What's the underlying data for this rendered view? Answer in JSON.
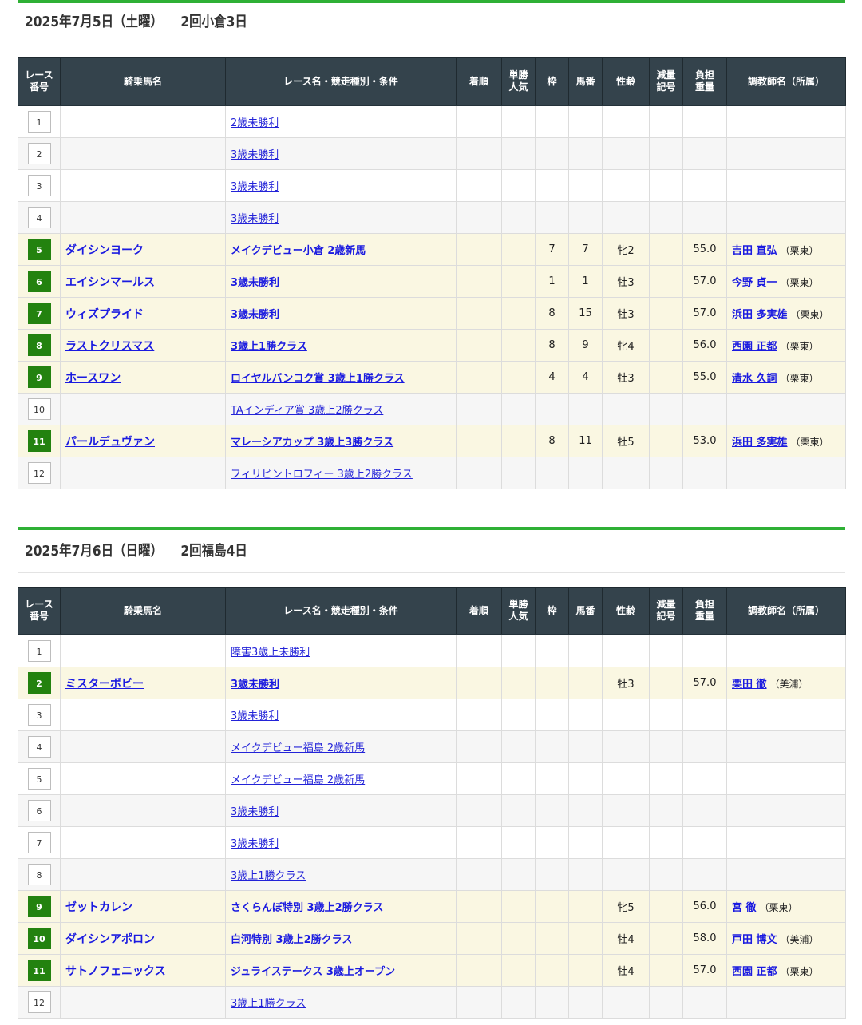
{
  "headers": {
    "race_num": "レース番号",
    "horse": "騎乗馬名",
    "race": "レース名・競走種別・条件",
    "rank": "着順",
    "pop": "単勝人気",
    "waku": "枠",
    "umaban": "馬番",
    "sexage": "性齢",
    "gen": "減量記号",
    "weight": "負担重量",
    "trainer": "調教師名（所属）"
  },
  "days": [
    {
      "date": "2025年7月5日（土曜）",
      "venue": "2回小倉3日",
      "races": [
        {
          "no": "1",
          "race": "2歳未勝利"
        },
        {
          "no": "2",
          "race": "3歳未勝利"
        },
        {
          "no": "3",
          "race": "3歳未勝利"
        },
        {
          "no": "4",
          "race": "3歳未勝利"
        },
        {
          "no": "5",
          "horse": "ダイシンヨーク",
          "race": "メイクデビュー小倉 2歳新馬",
          "waku": "7",
          "umaban": "7",
          "sexage": "牝2",
          "weight": "55.0",
          "trainer": "吉田 直弘",
          "aff": "（栗東）"
        },
        {
          "no": "6",
          "horse": "エイシンマールス",
          "race": "3歳未勝利",
          "waku": "1",
          "umaban": "1",
          "sexage": "牡3",
          "weight": "57.0",
          "trainer": "今野 貞一",
          "aff": "（栗東）"
        },
        {
          "no": "7",
          "horse": "ウィズプライド",
          "race": "3歳未勝利",
          "waku": "8",
          "umaban": "15",
          "sexage": "牡3",
          "weight": "57.0",
          "trainer": "浜田 多実雄",
          "aff": "（栗東）"
        },
        {
          "no": "8",
          "horse": "ラストクリスマス",
          "race": "3歳上1勝クラス",
          "waku": "8",
          "umaban": "9",
          "sexage": "牝4",
          "weight": "56.0",
          "trainer": "西園 正都",
          "aff": "（栗東）"
        },
        {
          "no": "9",
          "horse": "ホースワン",
          "race": "ロイヤルバンコク賞 3歳上1勝クラス",
          "waku": "4",
          "umaban": "4",
          "sexage": "牡3",
          "weight": "55.0",
          "trainer": "清水 久詞",
          "aff": "（栗東）"
        },
        {
          "no": "10",
          "race": "TAインディア賞 3歳上2勝クラス"
        },
        {
          "no": "11",
          "horse": "パールデュヴァン",
          "race": "マレーシアカップ 3歳上3勝クラス",
          "waku": "8",
          "umaban": "11",
          "sexage": "牡5",
          "weight": "53.0",
          "trainer": "浜田 多実雄",
          "aff": "（栗東）"
        },
        {
          "no": "12",
          "race": "フィリピントロフィー 3歳上2勝クラス"
        }
      ]
    },
    {
      "date": "2025年7月6日（日曜）",
      "venue": "2回福島4日",
      "races": [
        {
          "no": "1",
          "race": "障害3歳上未勝利"
        },
        {
          "no": "2",
          "horse": "ミスターボビー",
          "race": "3歳未勝利",
          "sexage": "牡3",
          "weight": "57.0",
          "trainer": "栗田 徹",
          "aff": "（美浦）"
        },
        {
          "no": "3",
          "race": "3歳未勝利"
        },
        {
          "no": "4",
          "race": "メイクデビュー福島 2歳新馬"
        },
        {
          "no": "5",
          "race": "メイクデビュー福島 2歳新馬"
        },
        {
          "no": "6",
          "race": "3歳未勝利"
        },
        {
          "no": "7",
          "race": "3歳未勝利"
        },
        {
          "no": "8",
          "race": "3歳上1勝クラス"
        },
        {
          "no": "9",
          "horse": "ゼットカレン",
          "race": "さくらんぼ特別 3歳上2勝クラス",
          "sexage": "牝5",
          "weight": "56.0",
          "trainer": "宮 徹",
          "aff": "（栗東）"
        },
        {
          "no": "10",
          "horse": "ダイシンアポロン",
          "race": "白河特別 3歳上2勝クラス",
          "sexage": "牡4",
          "weight": "58.0",
          "trainer": "戸田 博文",
          "aff": "（美浦）"
        },
        {
          "no": "11",
          "horse": "サトノフェニックス",
          "race": "ジュライステークス 3歳上オープン",
          "sexage": "牡4",
          "weight": "57.0",
          "trainer": "西園 正都",
          "aff": "（栗東）"
        },
        {
          "no": "12",
          "race": "3歳上1勝クラス"
        }
      ]
    }
  ]
}
